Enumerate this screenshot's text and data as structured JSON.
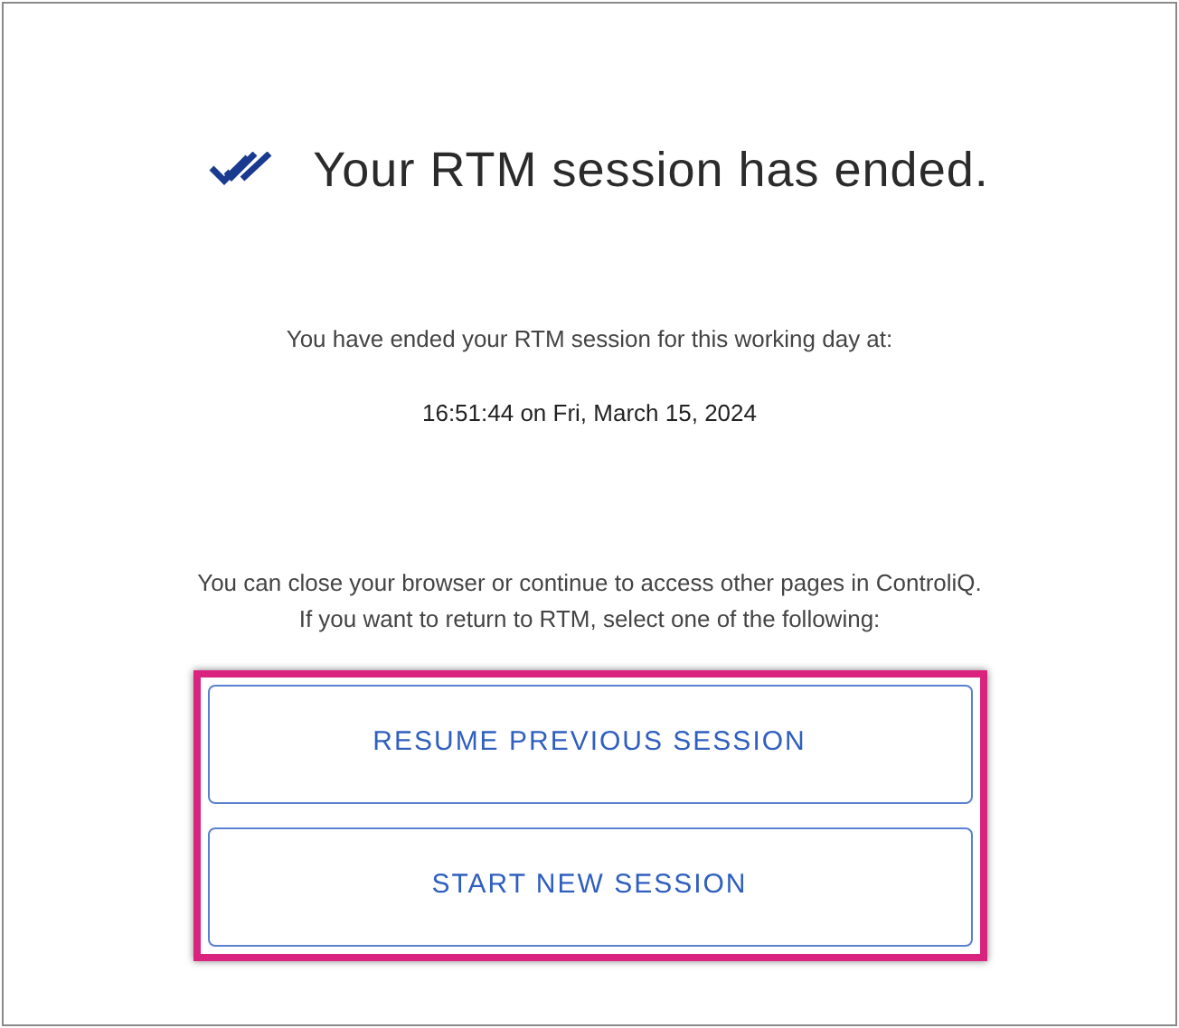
{
  "title": "Your RTM session has ended.",
  "ended_message": "You have ended your RTM session for this working day at:",
  "ended_time": "16:51:44 on Fri, March 15, 2024",
  "info_lines": [
    "You can close your browser or continue to access other pages in ControliQ.",
    "If you want to return to RTM, select one of the following:"
  ],
  "buttons": [
    {
      "label": "RESUME PREVIOUS SESSION"
    },
    {
      "label": "START NEW SESSION"
    }
  ]
}
